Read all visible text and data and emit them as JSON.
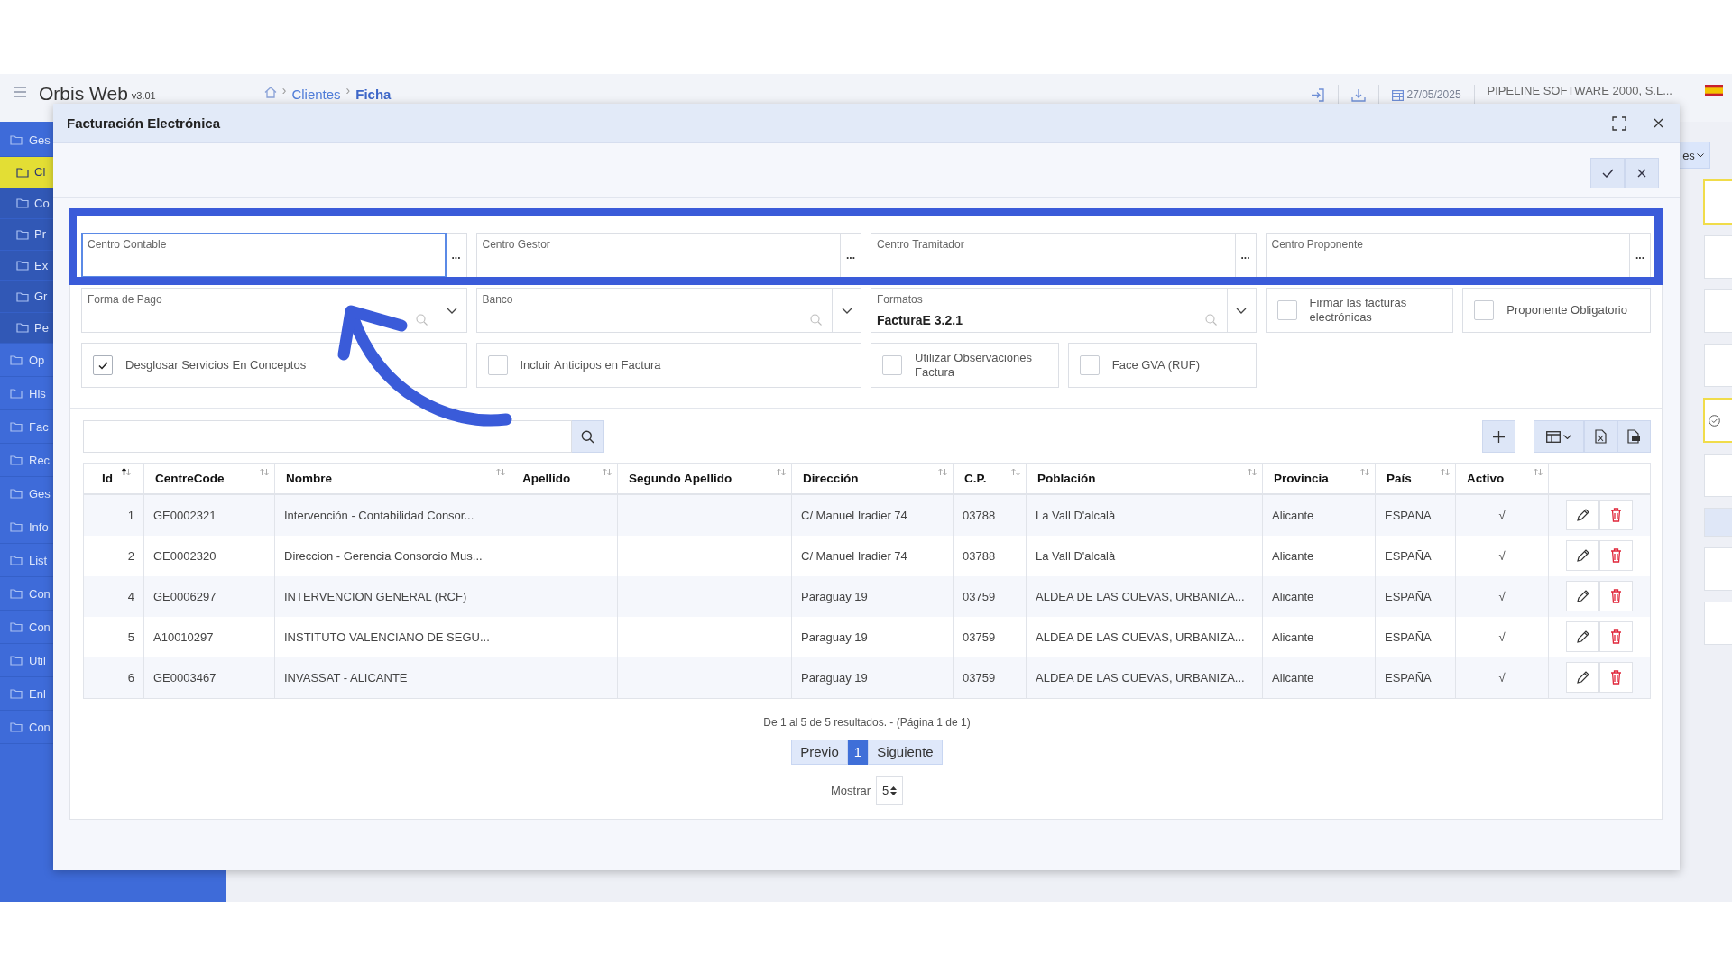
{
  "app": {
    "title": "Orbis Web",
    "version": "v3.01",
    "breadcrumb": [
      {
        "separator": "›",
        "label": "Clientes",
        "current": false
      },
      {
        "separator": "›",
        "label": "Ficha",
        "current": true
      }
    ],
    "date": "27/05/2025",
    "company": "PIPELINE SOFTWARE 2000, S.L..."
  },
  "sidebar": {
    "items": [
      {
        "label": "Ges",
        "kind": "section",
        "selected": false
      },
      {
        "label": "Cl",
        "kind": "subitem",
        "selected": true
      },
      {
        "label": "Co",
        "kind": "subitem",
        "selected": false
      },
      {
        "label": "Pr",
        "kind": "subitem",
        "selected": false
      },
      {
        "label": "Ex",
        "kind": "subitem",
        "selected": false
      },
      {
        "label": "Gr",
        "kind": "subitem",
        "selected": false
      },
      {
        "label": "Pe",
        "kind": "subitem",
        "selected": false
      },
      {
        "label": "Op",
        "kind": "section",
        "selected": false
      },
      {
        "label": "His",
        "kind": "section",
        "selected": false
      },
      {
        "label": "Fac",
        "kind": "section",
        "selected": false
      },
      {
        "label": "Rec",
        "kind": "section",
        "selected": false
      },
      {
        "label": "Ges",
        "kind": "section",
        "selected": false
      },
      {
        "label": "Info",
        "kind": "section",
        "selected": false
      },
      {
        "label": "List",
        "kind": "section",
        "selected": false
      },
      {
        "label": "Con",
        "kind": "section",
        "selected": false
      },
      {
        "label": "Con",
        "kind": "section",
        "selected": false
      },
      {
        "label": "Util",
        "kind": "section",
        "selected": false
      },
      {
        "label": "Enl",
        "kind": "section",
        "selected": false
      },
      {
        "label": "Con",
        "kind": "section",
        "selected": false
      }
    ]
  },
  "background_button": "es",
  "dialog": {
    "title": "Facturación Electrónica",
    "form_rows": [
      {
        "fields": [
          {
            "kind": "lookup",
            "label": "Centro Contable",
            "focused": true,
            "button": "..."
          },
          {
            "kind": "lookup",
            "label": "Centro Gestor",
            "focused": false,
            "button": "..."
          },
          {
            "kind": "lookup",
            "label": "Centro Tramitador",
            "focused": false,
            "button": "..."
          },
          {
            "kind": "lookup",
            "label": "Centro Proponente",
            "focused": false,
            "button": "..."
          }
        ]
      },
      {
        "fields": [
          {
            "kind": "select",
            "label": "Forma de Pago"
          },
          {
            "kind": "select",
            "label": "Banco"
          },
          {
            "kind": "select",
            "label": "Formatos",
            "value": "FacturaE 3.2.1"
          },
          {
            "kind": "checkbox",
            "label": "Firmar las facturas electrónicas",
            "checked": false
          },
          {
            "kind": "checkbox",
            "label": "Proponente Obligatorio",
            "checked": false
          }
        ]
      },
      {
        "fields": [
          {
            "kind": "checkbox",
            "label": "Desglosar Servicios En Conceptos",
            "checked": true
          },
          {
            "kind": "checkbox",
            "label": "Incluir Anticipos en Factura",
            "checked": false
          },
          {
            "kind": "checkbox",
            "label": "Utilizar Observaciones Factura",
            "checked": false
          },
          {
            "kind": "checkbox",
            "label": "Face GVA (RUF)",
            "checked": false
          }
        ]
      }
    ],
    "table": {
      "columns": [
        {
          "label": "Id",
          "sorted": true
        },
        {
          "label": "CentreCode",
          "sorted": false
        },
        {
          "label": "Nombre",
          "sorted": false
        },
        {
          "label": "Apellido",
          "sorted": false
        },
        {
          "label": "Segundo Apellido",
          "sorted": false
        },
        {
          "label": "Dirección",
          "sorted": false
        },
        {
          "label": "C.P.",
          "sorted": false
        },
        {
          "label": "Población",
          "sorted": false
        },
        {
          "label": "Provincia",
          "sorted": false
        },
        {
          "label": "País",
          "sorted": false
        },
        {
          "label": "Activo",
          "sorted": false
        }
      ],
      "rows": [
        {
          "id": "1",
          "centre_code": "GE0002321",
          "nombre": "Intervención - Contabilidad Consor...",
          "direccion": "C/ Manuel Iradier 74",
          "cp": "03788",
          "poblacion": "La Vall D'alcalà",
          "provincia": "Alicante",
          "pais": "ESPAÑA",
          "activo": "√"
        },
        {
          "id": "2",
          "centre_code": "GE0002320",
          "nombre": "Direccion - Gerencia Consorcio Mus...",
          "direccion": "C/ Manuel Iradier 74",
          "cp": "03788",
          "poblacion": "La Vall D'alcalà",
          "provincia": "Alicante",
          "pais": "ESPAÑA",
          "activo": "√"
        },
        {
          "id": "4",
          "centre_code": "GE0006297",
          "nombre": "INTERVENCION GENERAL (RCF)",
          "direccion": "Paraguay 19",
          "cp": "03759",
          "poblacion": "ALDEA DE LAS CUEVAS, URBANIZA...",
          "provincia": "Alicante",
          "pais": "ESPAÑA",
          "activo": "√"
        },
        {
          "id": "5",
          "centre_code": "A10010297",
          "nombre": "INSTITUTO VALENCIANO DE SEGU...",
          "direccion": "Paraguay 19",
          "cp": "03759",
          "poblacion": "ALDEA DE LAS CUEVAS, URBANIZA...",
          "provincia": "Alicante",
          "pais": "ESPAÑA",
          "activo": "√"
        },
        {
          "id": "6",
          "centre_code": "GE0003467",
          "nombre": "INVASSAT - ALICANTE",
          "direccion": "Paraguay 19",
          "cp": "03759",
          "poblacion": "ALDEA DE LAS CUEVAS, URBANIZA...",
          "provincia": "Alicante",
          "pais": "ESPAÑA",
          "activo": "√"
        }
      ]
    },
    "pagination": {
      "summary": "De 1 al 5 de 5 resultados. - (Página 1 de 1)",
      "pages": [
        {
          "label": "Previo",
          "selected": false
        },
        {
          "label": "1",
          "selected": true
        },
        {
          "label": "Siguiente",
          "selected": false
        }
      ],
      "show_label": "Mostrar",
      "page_size": "5"
    }
  }
}
